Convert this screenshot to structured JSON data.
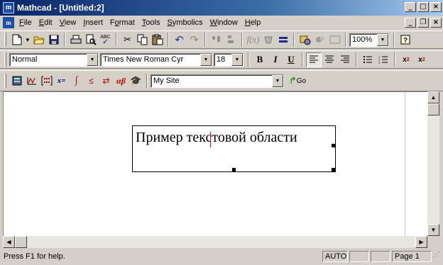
{
  "window": {
    "app_icon_letter": "m",
    "title": "Mathcad - [Untitled:2]",
    "buttons": {
      "minimize": "_",
      "maximize": "□",
      "close": "×"
    }
  },
  "menu": {
    "doc_icon_letter": "m",
    "items": [
      {
        "label": "File",
        "accel": "F"
      },
      {
        "label": "Edit",
        "accel": "E"
      },
      {
        "label": "View",
        "accel": "V"
      },
      {
        "label": "Insert",
        "accel": "I"
      },
      {
        "label": "Format",
        "accel": "o"
      },
      {
        "label": "Tools",
        "accel": "T"
      },
      {
        "label": "Symbolics",
        "accel": "S"
      },
      {
        "label": "Window",
        "accel": "W"
      },
      {
        "label": "Help",
        "accel": "H"
      }
    ]
  },
  "standard_toolbar": {
    "icons": [
      "new-doc-icon",
      "open-folder-icon",
      "save-icon",
      "print-icon",
      "print-preview-icon",
      "spell-check-icon",
      "cut-icon",
      "copy-icon",
      "paste-icon",
      "undo-icon",
      "redo-icon",
      "align-across-icon",
      "align-down-icon",
      "evaluate-icon",
      "insert-function-icon",
      "insert-unit-icon",
      "component-icon",
      "resources-icon",
      "help-icon"
    ],
    "zoom": "100%",
    "spell_check_label": "ABC"
  },
  "format_toolbar": {
    "style": "Normal",
    "font": "Times New Roman Cyr",
    "size": "18",
    "bold": "B",
    "italic": "I",
    "underline": "U",
    "superscript": "x",
    "superscript_mark": "2",
    "subscript": "x",
    "subscript_mark": "2"
  },
  "math_toolbar": {
    "evaluation_label": "x=",
    "greek_label": "αβ",
    "resource": "My Site",
    "go_label": "Go"
  },
  "document": {
    "text_region": "Пример текстовой области"
  },
  "status": {
    "help": "Press F1 for help.",
    "mode": "AUTO",
    "page": "Page 1"
  }
}
